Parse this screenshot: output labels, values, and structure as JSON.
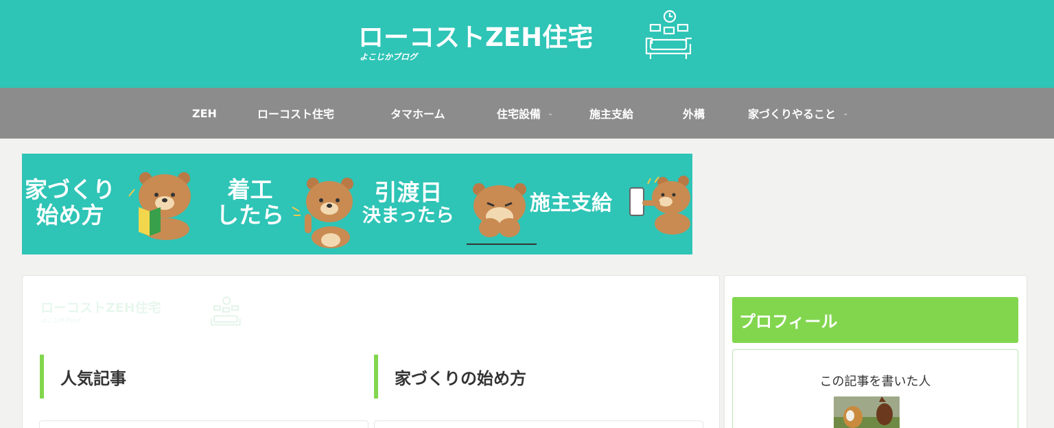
{
  "header": {
    "site_title": "ローコストZEH住宅",
    "site_subtitle": "よこじかブログ",
    "logo_icon": "living-room-icon",
    "background": "#2ec4b6"
  },
  "nav": {
    "background": "#8c8c8c",
    "items": [
      {
        "label": "ZEH",
        "has_dropdown": false
      },
      {
        "label": "ローコスト住宅",
        "has_dropdown": false
      },
      {
        "label": "タマホーム",
        "has_dropdown": false
      },
      {
        "label": "住宅設備",
        "has_dropdown": true
      },
      {
        "label": "施主支給",
        "has_dropdown": false
      },
      {
        "label": "外構",
        "has_dropdown": false
      },
      {
        "label": "家づくりやること",
        "has_dropdown": true
      }
    ],
    "dropdown_icon": "chevron-down-icon",
    "dropdown_glyph": "⌄"
  },
  "banner": {
    "background": "#2ec4b6",
    "panels": [
      {
        "line1": "家づくり",
        "line2": "始め方",
        "bear": "bear-holding-book-icon"
      },
      {
        "line1": "着工",
        "line2": "したら",
        "bear": "bear-pointing-icon"
      },
      {
        "line1": "引渡日",
        "line2": "決まったら",
        "bear": "bear-thinking-icon"
      },
      {
        "line1": "施主支給",
        "line2": "",
        "bear": "bear-with-phone-icon"
      }
    ]
  },
  "main": {
    "ghost_logo_title": "ローコストZEH住宅",
    "ghost_logo_subtitle": "よこじかブログ",
    "sections": [
      {
        "title": "人気記事"
      },
      {
        "title": "家づくりの始め方"
      }
    ],
    "accent": "#82d64e"
  },
  "sidebar": {
    "profile_title": "プロフィール",
    "writer_label": "この記事を書いた人",
    "avatar": "author-avatar-dogs",
    "accent": "#82d64e"
  }
}
